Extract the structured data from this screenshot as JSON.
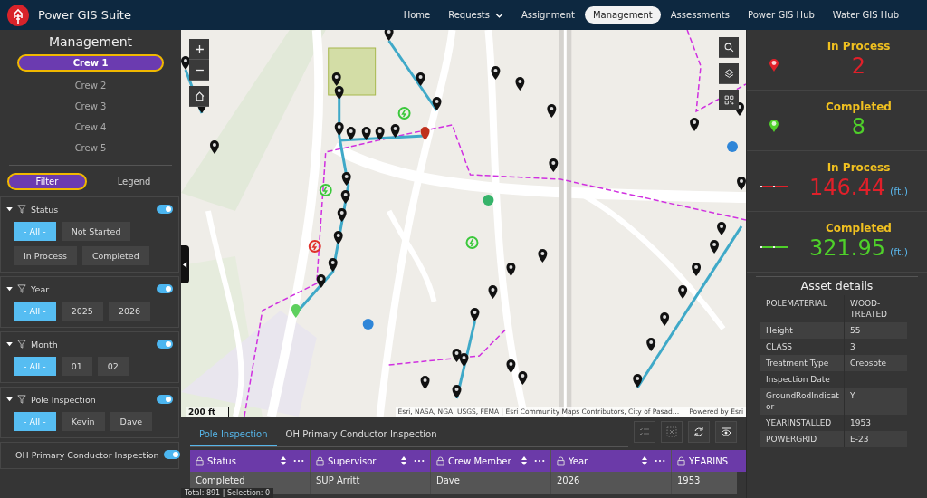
{
  "app": {
    "title": "Power GIS Suite"
  },
  "nav": [
    {
      "label": "Home",
      "selected": false,
      "dropdown": false
    },
    {
      "label": "Requests",
      "selected": false,
      "dropdown": true
    },
    {
      "label": "Assignment",
      "selected": false,
      "dropdown": false
    },
    {
      "label": "Management",
      "selected": true,
      "dropdown": false
    },
    {
      "label": "Assessments",
      "selected": false,
      "dropdown": false
    },
    {
      "label": "Power GIS Hub",
      "selected": false,
      "dropdown": false
    },
    {
      "label": "Water GIS Hub",
      "selected": false,
      "dropdown": false
    }
  ],
  "sidebar": {
    "title": "Management",
    "crews": [
      {
        "label": "Crew 1",
        "selected": true
      },
      {
        "label": "Crew 2",
        "selected": false
      },
      {
        "label": "Crew 3",
        "selected": false
      },
      {
        "label": "Crew 4",
        "selected": false
      },
      {
        "label": "Crew 5",
        "selected": false
      }
    ],
    "panel_tabs": [
      {
        "label": "Filter",
        "selected": true
      },
      {
        "label": "Legend",
        "selected": false
      }
    ],
    "filters": [
      {
        "title": "Status",
        "on": true,
        "options": [
          {
            "label": "- All -",
            "selected": true
          },
          {
            "label": "Not Started",
            "selected": false
          },
          {
            "label": "In Process",
            "selected": false
          },
          {
            "label": "Completed",
            "selected": false
          }
        ]
      },
      {
        "title": "Year",
        "on": true,
        "options": [
          {
            "label": "- All -",
            "selected": true
          },
          {
            "label": "2025",
            "selected": false
          },
          {
            "label": "2026",
            "selected": false
          }
        ]
      },
      {
        "title": "Month",
        "on": true,
        "options": [
          {
            "label": "- All -",
            "selected": true
          },
          {
            "label": "01",
            "selected": false
          },
          {
            "label": "02",
            "selected": false
          }
        ]
      },
      {
        "title": "Pole Inspection",
        "on": true,
        "options": [
          {
            "label": "- All -",
            "selected": true
          },
          {
            "label": "Kevin",
            "selected": false
          },
          {
            "label": "Dave",
            "selected": false
          }
        ]
      },
      {
        "title": "OH Primary Conductor Inspection",
        "on": true
      }
    ]
  },
  "map": {
    "scale": "200 ft",
    "attribution": "Esri, NASA, NGA, USGS, FEMA | Esri Community Maps Contributors, City of Pasad…",
    "powered_by": "Powered by Esri"
  },
  "table": {
    "tabs": [
      {
        "label": "Pole Inspection",
        "selected": true
      },
      {
        "label": "OH Primary Conductor Inspection",
        "selected": false
      }
    ],
    "tools": [
      {
        "kind": "select-all",
        "disabled": true
      },
      {
        "kind": "clear-selection",
        "disabled": true
      },
      {
        "kind": "refresh",
        "disabled": false
      },
      {
        "kind": "show-columns",
        "disabled": false
      }
    ],
    "columns": [
      "Status",
      "Supervisor",
      "Crew Member",
      "Year",
      "YEARINS"
    ],
    "rows": [
      [
        "Completed",
        "SUP Arritt",
        "Dave",
        "2026",
        "1953"
      ]
    ],
    "footer": "Total: 891 | Selection: 0"
  },
  "stats": [
    {
      "kind": "point",
      "label": "In Process",
      "value": "2",
      "color": "#e0202a"
    },
    {
      "kind": "point",
      "label": "Completed",
      "value": "8",
      "color": "#4fd02a"
    },
    {
      "kind": "line",
      "label": "In Process",
      "value": "146.44",
      "unit": "(ft.)",
      "color": "#e0202a"
    },
    {
      "kind": "line",
      "label": "Completed",
      "value": "321.95",
      "unit": "(ft.)",
      "color": "#4fd02a"
    }
  ],
  "asset_details": {
    "title": "Asset details",
    "rows": [
      {
        "field": "POLEMATERIAL",
        "value": "WOOD-TREATED"
      },
      {
        "field": "Height",
        "value": "55"
      },
      {
        "field": "CLASS",
        "value": "3"
      },
      {
        "field": "Treatment Type",
        "value": "Creosote"
      },
      {
        "field": "Inspection Date"
      },
      {
        "field": "GroundRodIndicator",
        "value": "Y"
      },
      {
        "field": "YEARINSTALLED",
        "value": "1953"
      },
      {
        "field": "POWERGRID",
        "value": "E-23"
      }
    ]
  }
}
